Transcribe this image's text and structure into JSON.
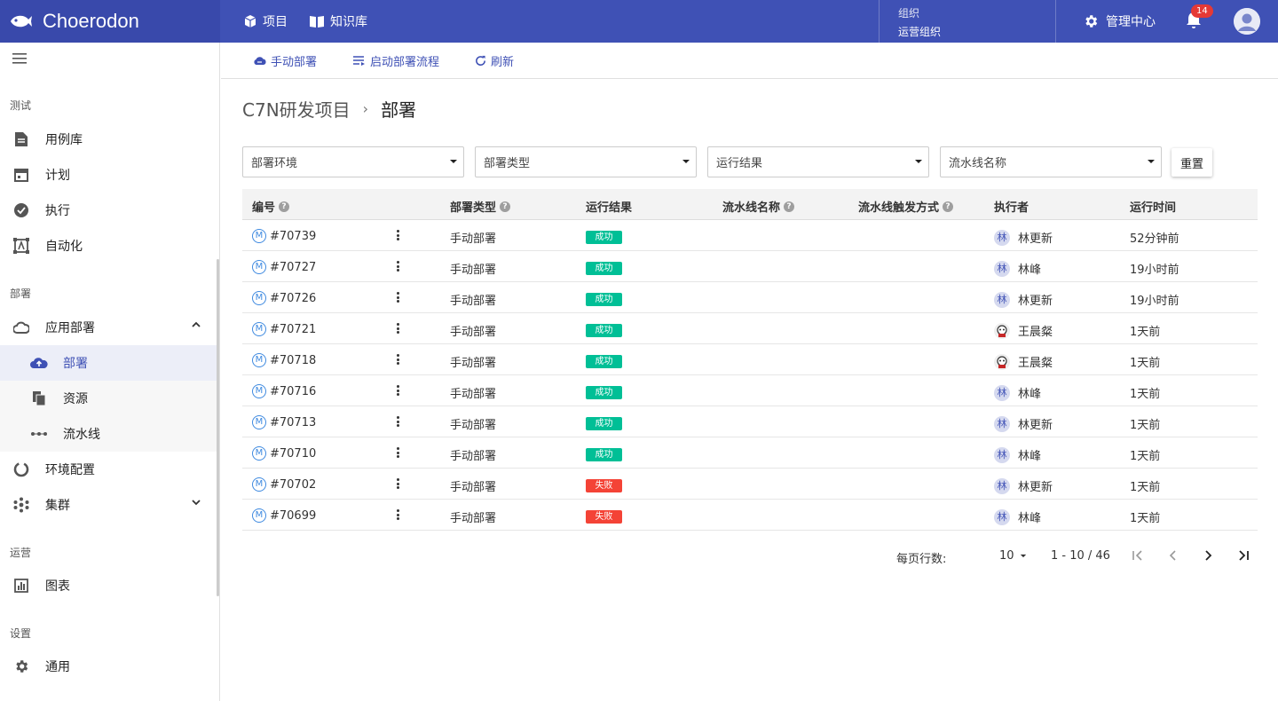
{
  "header": {
    "logo": "Choerodon",
    "nav": [
      {
        "label": "项目",
        "icon": "cube-icon"
      },
      {
        "label": "知识库",
        "icon": "book-icon"
      }
    ],
    "org_label": "组织",
    "org_value": "运营组织",
    "manage": "管理中心",
    "notification_count": "14"
  },
  "sidebar": {
    "sections": [
      "测试",
      "部署",
      "运营",
      "设置"
    ],
    "items": [
      {
        "label": "用例库",
        "icon": "document-icon"
      },
      {
        "label": "计划",
        "icon": "calendar-icon"
      },
      {
        "label": "执行",
        "icon": "check-circle-icon"
      },
      {
        "label": "自动化",
        "icon": "automation-icon"
      },
      {
        "label": "应用部署",
        "icon": "cloud-icon"
      },
      {
        "label": "部署",
        "icon": "cloud-upload-icon"
      },
      {
        "label": "资源",
        "icon": "files-icon"
      },
      {
        "label": "流水线",
        "icon": "pipeline-icon"
      },
      {
        "label": "环境配置",
        "icon": "ring-icon"
      },
      {
        "label": "集群",
        "icon": "cluster-icon"
      },
      {
        "label": "图表",
        "icon": "chart-icon"
      },
      {
        "label": "通用",
        "icon": "gear-icon"
      }
    ]
  },
  "toolbar": {
    "manual_deploy": "手动部署",
    "start_flow": "启动部署流程",
    "refresh": "刷新"
  },
  "breadcrumb": {
    "project": "C7N研发项目",
    "separator": "›",
    "current": "部署"
  },
  "filters": [
    "部署环境",
    "部署类型",
    "运行结果",
    "流水线名称"
  ],
  "reset": "重置",
  "table": {
    "columns": [
      "编号",
      "部署类型",
      "运行结果",
      "流水线名称",
      "流水线触发方式",
      "执行者",
      "运行时间"
    ],
    "rows": [
      {
        "id": "#70739",
        "type": "手动部署",
        "result": "成功",
        "avatar": "林",
        "executor": "林更新",
        "time": "52分钟前"
      },
      {
        "id": "#70727",
        "type": "手动部署",
        "result": "成功",
        "avatar": "林",
        "executor": "林峰",
        "time": "19小时前"
      },
      {
        "id": "#70726",
        "type": "手动部署",
        "result": "成功",
        "avatar": "林",
        "executor": "林更新",
        "time": "19小时前"
      },
      {
        "id": "#70721",
        "type": "手动部署",
        "result": "成功",
        "avatar": "",
        "executor": "王晨粲",
        "time": "1天前"
      },
      {
        "id": "#70718",
        "type": "手动部署",
        "result": "成功",
        "avatar": "",
        "executor": "王晨粲",
        "time": "1天前"
      },
      {
        "id": "#70716",
        "type": "手动部署",
        "result": "成功",
        "avatar": "林",
        "executor": "林峰",
        "time": "1天前"
      },
      {
        "id": "#70713",
        "type": "手动部署",
        "result": "成功",
        "avatar": "林",
        "executor": "林更新",
        "time": "1天前"
      },
      {
        "id": "#70710",
        "type": "手动部署",
        "result": "成功",
        "avatar": "林",
        "executor": "林峰",
        "time": "1天前"
      },
      {
        "id": "#70702",
        "type": "手动部署",
        "result": "失败",
        "avatar": "林",
        "executor": "林更新",
        "time": "1天前"
      },
      {
        "id": "#70699",
        "type": "手动部署",
        "result": "失败",
        "avatar": "林",
        "executor": "林峰",
        "time": "1天前"
      }
    ],
    "mode_icon_letter": "M"
  },
  "colors": {
    "primary": "#3f51b5",
    "success": "#00bf96",
    "fail": "#f44336"
  },
  "pagination": {
    "label": "每页行数:",
    "page_size": "10",
    "range": "1 - 10 / 46"
  }
}
